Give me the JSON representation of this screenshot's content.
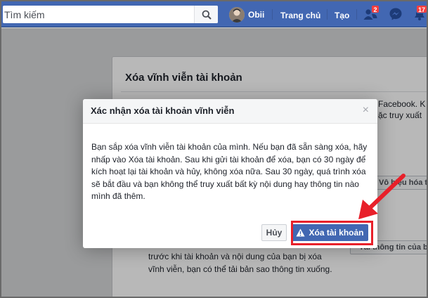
{
  "topbar": {
    "search_placeholder": "Tìm kiếm",
    "profile_name": "Obii",
    "home_label": "Trang chủ",
    "create_label": "Tạo",
    "friend_requests_count": "2",
    "notifications_count": "17"
  },
  "background_page": {
    "section_title": "Xóa vĩnh viễn tài khoản",
    "snippet_line1": "Facebook. K",
    "snippet_line2": "ặc truy xuất",
    "deactivate_button": "Vô hiệu hóa t",
    "download_button": "Tải thông tin của b",
    "paragraph": "trước khi tài khoản và nội dung của bạn bị xóa vĩnh viễn, bạn có thể tải bản sao thông tin xuống."
  },
  "dialog": {
    "title": "Xác nhận xóa tài khoản vĩnh viễn",
    "close_glyph": "×",
    "body": "Bạn sắp xóa vĩnh viễn tài khoản của mình. Nếu bạn đã sẵn sàng xóa, hãy nhấp vào Xóa tài khoản. Sau khi gửi tài khoản để xóa, bạn có 30 ngày để kích hoạt lại tài khoản và hủy, không xóa nữa. Sau 30 ngày, quá trình xóa sẽ bắt đầu và bạn không thể truy xuất bất kỳ nội dung hay thông tin nào mình đã thêm.",
    "cancel_label": "Hủy",
    "delete_label": "Xóa tài khoản"
  },
  "colors": {
    "brand_blue": "#4267b2",
    "badge_red": "#fa3e3e",
    "annotation_red": "#e8202a"
  },
  "icons": [
    "search-icon",
    "friends-icon",
    "messenger-icon",
    "notifications-icon",
    "close-icon",
    "warning-icon",
    "annotation-arrow"
  ]
}
